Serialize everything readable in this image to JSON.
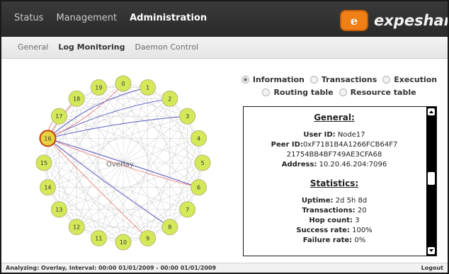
{
  "top_nav": {
    "items": [
      "Status",
      "Management",
      "Administration"
    ],
    "active_index": 2
  },
  "logo": {
    "text": "expeshare",
    "badge_glyph": "e"
  },
  "sub_nav": {
    "items": [
      "General",
      "Log Monitoring",
      "Daemon Control"
    ],
    "active_index": 1
  },
  "graph": {
    "label": "Overlay",
    "nodes": [
      "0",
      "1",
      "2",
      "3",
      "4",
      "5",
      "6",
      "7",
      "8",
      "9",
      "10",
      "11",
      "12",
      "13",
      "14",
      "15",
      "16",
      "17",
      "18",
      "19"
    ],
    "highlight_node": "16",
    "colors": {
      "node_fill": "#d5e85a",
      "node_stroke": "#b8b96b",
      "highlight_fill": "#e8d240",
      "highlight_stroke": "#c2410c",
      "edge_blue": "#5e5ec6",
      "edge_red": "#e26e6e",
      "mesh": "#cfcfcf"
    }
  },
  "radio_tabs": {
    "row1": [
      "Information",
      "Transactions",
      "Execution"
    ],
    "row2": [
      "Routing table",
      "Resource table"
    ],
    "selected": "Information"
  },
  "panel": {
    "general_title": "General:",
    "user_id_label": "User ID:",
    "user_id_value": "Node17",
    "peer_id_label": "Peer ID:",
    "peer_id_value_line1": "0xF7181B4A1266FCB64F7",
    "peer_id_value_line2": "21754BB4BF749AE3CFA68",
    "address_label": "Address:",
    "address_value": "10.20.46.204:7096",
    "stats_title": "Statistics:",
    "uptime_label": "Uptime:",
    "uptime_value": "2d 5h 8d",
    "transactions_label": "Transactions:",
    "transactions_value": "20",
    "hop_label": "Hop count:",
    "hop_value": "3",
    "success_label": "Success rate:",
    "success_value": "100%",
    "failure_label": "Failure rate:",
    "failure_value": "0%"
  },
  "statusbar": {
    "left": "Analyzing: Overlay, Interval: 00:00 01/01/2009 - 00:00 01/01/2009",
    "right": "Logout"
  }
}
